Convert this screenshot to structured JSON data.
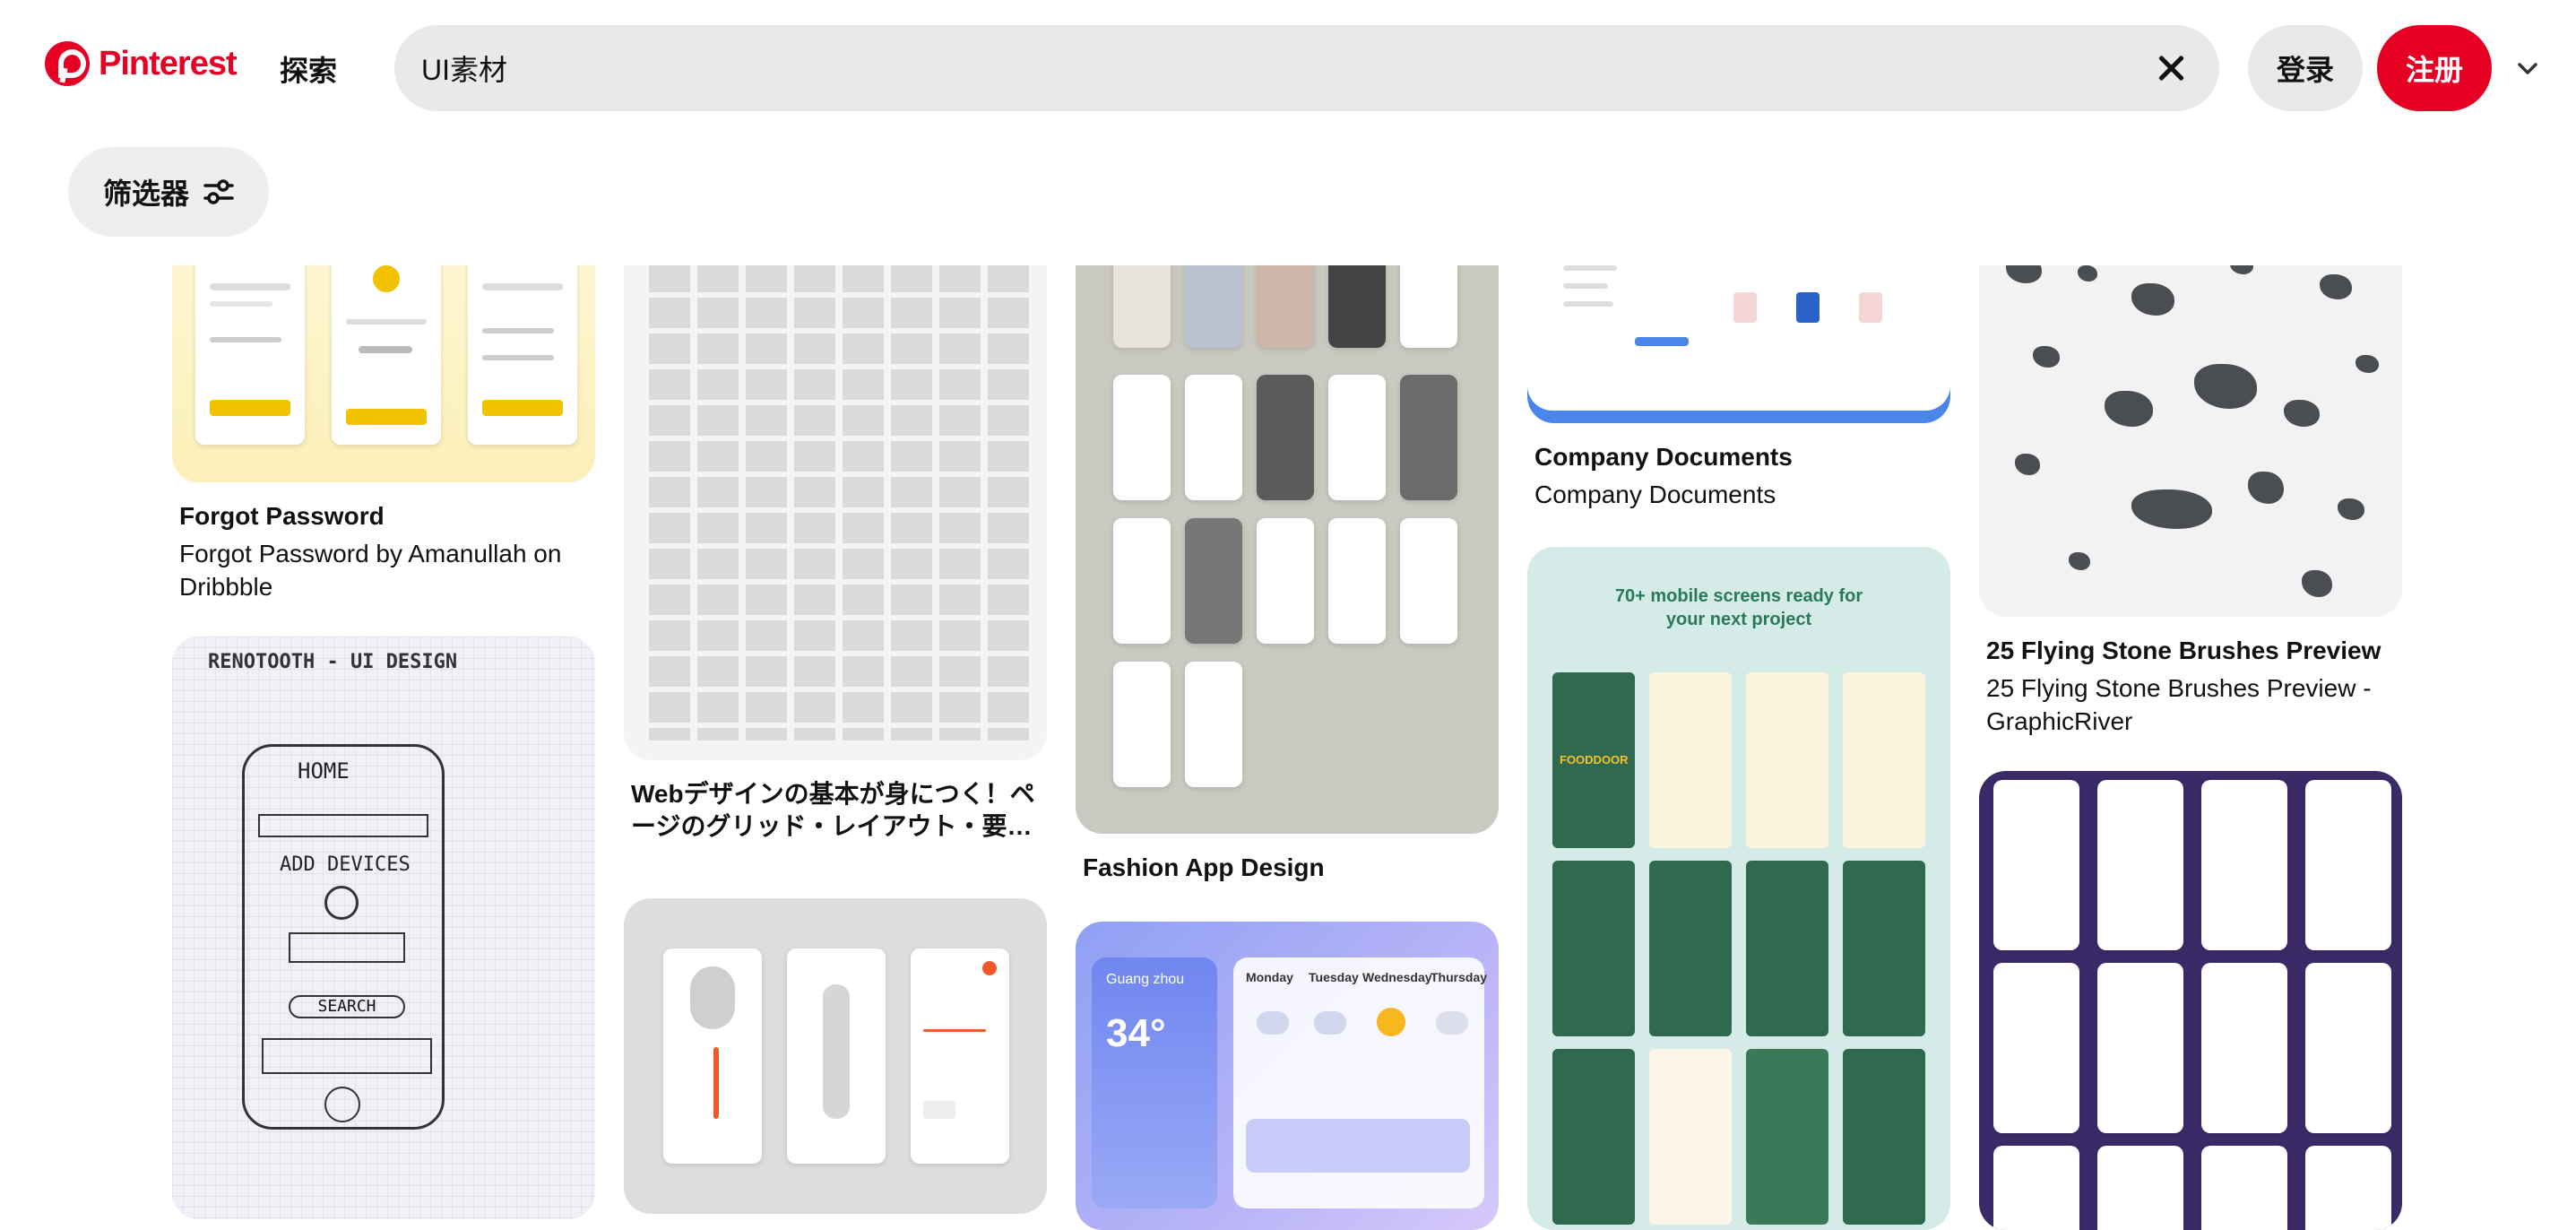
{
  "header": {
    "brand": "Pinterest",
    "explore": "探索",
    "search_value": "UI素材",
    "login": "登录",
    "signup": "注册"
  },
  "filter": {
    "label": "筛选器"
  },
  "colors": {
    "brand_red": "#e60023",
    "chip_gray": "#e9e9e9"
  },
  "pins": [
    {
      "title": "Forgot Password",
      "subtitle": "Forgot Password by Amanullah on Dribbble"
    },
    {
      "title": "Webデザインの基本が身につく！ページのグリッド・レイアウト・要…",
      "subtitle": ""
    },
    {
      "title": "Fashion App Design",
      "subtitle": ""
    },
    {
      "title": "Company Documents",
      "subtitle": "Company Documents"
    },
    {
      "title": "25 Flying Stone Brushes Preview",
      "subtitle": "25 Flying Stone Brushes Preview - GraphicRiver"
    }
  ],
  "images": {
    "sketch": {
      "title": "RENOTOOTH - UI DESIGN",
      "home": "HOME",
      "add_devices": "ADD DEVICES",
      "search": "SEARCH"
    },
    "food": {
      "headline": "70+ mobile screens ready for your next project",
      "brand": "FOODDOOR"
    },
    "weather": {
      "city": "Guang zhou",
      "temp": "34°",
      "days": [
        "Monday",
        "Tuesday",
        "Wednesday",
        "Thursday"
      ]
    }
  },
  "icons": [
    "pinterest-logo-icon",
    "close-icon",
    "chevron-down-icon",
    "filter-sliders-icon"
  ]
}
